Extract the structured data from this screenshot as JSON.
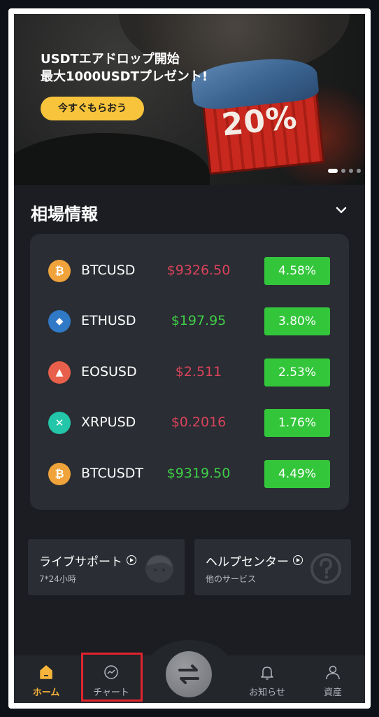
{
  "banner": {
    "title_line1": "USDTエアドロップ開始",
    "title_line2": "最大1000USDTプレゼント!",
    "cta_label": "今すぐもらおう",
    "crate_text": "20%",
    "slide_count": 4,
    "active_slide": 1
  },
  "market": {
    "title": "相場情報",
    "rows": [
      {
        "symbol": "BTCUSD",
        "price": "$9326.50",
        "price_trend": "down",
        "change": "4.58%",
        "icon": "bitcoin-icon",
        "icon_color": "#f0a33a",
        "icon_glyph": "₿"
      },
      {
        "symbol": "ETHUSD",
        "price": "$197.95",
        "price_trend": "up",
        "change": "3.80%",
        "icon": "ethereum-icon",
        "icon_color": "#2f79c6",
        "icon_glyph": "◆"
      },
      {
        "symbol": "EOSUSD",
        "price": "$2.511",
        "price_trend": "down",
        "change": "2.53%",
        "icon": "eos-icon",
        "icon_color": "#e8604b",
        "icon_glyph": "▲"
      },
      {
        "symbol": "XRPUSD",
        "price": "$0.2016",
        "price_trend": "down",
        "change": "1.76%",
        "icon": "ripple-icon",
        "icon_color": "#23c6a8",
        "icon_glyph": "✕"
      },
      {
        "symbol": "BTCUSDT",
        "price": "$9319.50",
        "price_trend": "up",
        "change": "4.49%",
        "icon": "bitcoin-icon",
        "icon_color": "#f0a33a",
        "icon_glyph": "₿"
      }
    ]
  },
  "services": [
    {
      "title": "ライブサポート",
      "subtitle": "7*24小時",
      "icon": "support-face-icon"
    },
    {
      "title": "ヘルプセンター",
      "subtitle": "他のサービス",
      "icon": "question-icon"
    }
  ],
  "nav": {
    "items": [
      {
        "label": "ホーム",
        "icon": "home-icon",
        "active": true
      },
      {
        "label": "チャート",
        "icon": "chart-icon",
        "active": false
      },
      {
        "label": "お知らせ",
        "icon": "bell-icon",
        "active": false
      },
      {
        "label": "資産",
        "icon": "user-icon",
        "active": false
      }
    ],
    "center_icon": "swap-icon"
  },
  "colors": {
    "accent": "#f7c43b",
    "price_up": "#3fcf48",
    "price_down": "#d9435b",
    "change_badge": "#33c63b",
    "highlight": "#e0242e"
  }
}
